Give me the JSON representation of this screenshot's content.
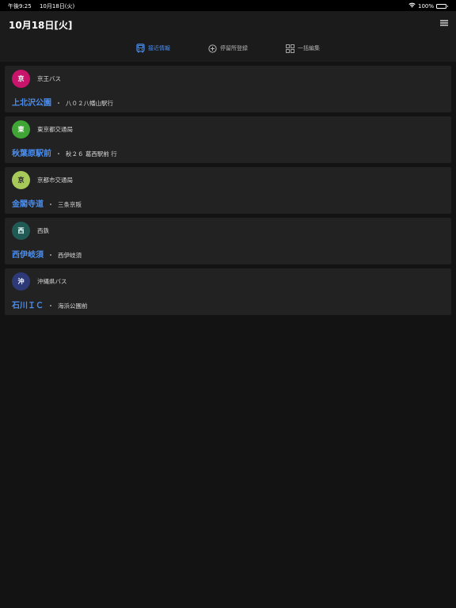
{
  "status_bar": {
    "time": "午後9:25",
    "date": "10月18日(火)",
    "battery": "100%",
    "battery_level": 1.0
  },
  "header": {
    "title": "10月18日[火]"
  },
  "tabs": [
    {
      "label": "接近情報",
      "icon": "bus-front-icon",
      "active": true
    },
    {
      "label": "停留所登録",
      "icon": "plus-circle-icon",
      "active": false
    },
    {
      "label": "一括編集",
      "icon": "grid-icon",
      "active": false
    }
  ],
  "stops": [
    {
      "badge": "京",
      "badge_color": "#c8146a",
      "badge_text_color": "#ffffff",
      "operator": "京王バス",
      "stop": "上北沢公園",
      "route": "八０２八幡山駅行"
    },
    {
      "badge": "東",
      "badge_color": "#3fa535",
      "badge_text_color": "#ffffff",
      "operator": "東京都交通局",
      "stop": "秋葉原駅前",
      "route": "秋２６ 葛西駅前 行"
    },
    {
      "badge": "京",
      "badge_color": "#a6c95a",
      "badge_text_color": "#1a1a1a",
      "operator": "京都市交通局",
      "stop": "金閣寺道",
      "route": "三条京阪"
    },
    {
      "badge": "西",
      "badge_color": "#1f5a55",
      "badge_text_color": "#ffffff",
      "operator": "西鉄",
      "stop": "西伊岐須",
      "route": "西伊岐須"
    },
    {
      "badge": "沖",
      "badge_color": "#2e3a78",
      "badge_text_color": "#ffffff",
      "operator": "沖縄県バス",
      "stop": "石川ＩＣ",
      "route": "海浜公園前"
    }
  ],
  "colors": {
    "accent": "#4a8ef0",
    "background": "#131313",
    "card": "#222222",
    "header": "#1b1b1b"
  }
}
